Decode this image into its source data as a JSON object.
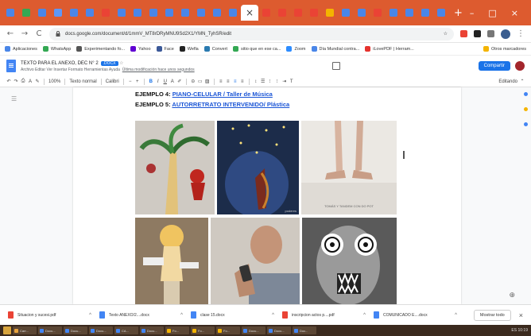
{
  "browser": {
    "tabs": [
      {
        "color": "#4a86e8"
      },
      {
        "color": "#34a853"
      },
      {
        "color": "#4a86e8"
      },
      {
        "color": "#5e97f6"
      },
      {
        "color": "#4a86e8"
      },
      {
        "color": "#4a86e8"
      },
      {
        "color": "#ea4335"
      },
      {
        "color": "#4a86e8"
      },
      {
        "color": "#4a86e8"
      },
      {
        "color": "#4a86e8"
      },
      {
        "color": "#4a86e8"
      },
      {
        "color": "#4a86e8"
      },
      {
        "color": "#4a86e8"
      },
      {
        "color": "#4a86e8"
      },
      {
        "color": "#4a86e8"
      }
    ],
    "active_tab_close": "×",
    "tabs_right": [
      {
        "color": "#ea4335"
      },
      {
        "color": "#ea4335"
      },
      {
        "color": "#ea4335"
      },
      {
        "color": "#ea4335"
      },
      {
        "color": "#f4b400"
      },
      {
        "color": "#4a86e8"
      },
      {
        "color": "#4a86e8"
      },
      {
        "color": "#ea4335"
      },
      {
        "color": "#4a86e8"
      },
      {
        "color": "#4a86e8"
      },
      {
        "color": "#4a86e8"
      },
      {
        "color": "#4a86e8"
      }
    ],
    "new_tab": "+",
    "window_controls": [
      "–",
      "□",
      "×"
    ],
    "url": "docs.google.com/document/d/1mmV_MT8rDRyMNU9Sd2X1/YMN_TyhSR/edit",
    "nav": {
      "back": "←",
      "forward": "→",
      "reload": "C"
    }
  },
  "bookmarks": [
    {
      "label": "Aplicaciones",
      "color": "#4a86e8"
    },
    {
      "label": "WhatsApp",
      "color": "#34a853"
    },
    {
      "label": "Experimentando fo...",
      "color": "#555555"
    },
    {
      "label": "Yahoo",
      "color": "#6001d2"
    },
    {
      "label": "Face",
      "color": "#3b5998"
    },
    {
      "label": "Wefla",
      "color": "#222222"
    },
    {
      "label": "Convert",
      "color": "#2a7ab0"
    },
    {
      "label": "sitio que en ese ca...",
      "color": "#34a853"
    },
    {
      "label": "Zoom",
      "color": "#2d8cff"
    },
    {
      "label": "Día Mundial contra...",
      "color": "#4a86e8"
    },
    {
      "label": "iLovePDF | Herram...",
      "color": "#e5322d"
    }
  ],
  "bookmarks_right": "Otros marcadores",
  "doc": {
    "title": "TEXTO PARA EL ANEXO, DEC N° 2",
    "title_badge": ".DOCX",
    "menu": "Archivo  Editar  Ver  Insertar  Formato  Herramientas  Ayuda",
    "edit_status": "Última modificación hace unos segundos",
    "share": "Compartir"
  },
  "toolbar": {
    "zoom": "100%",
    "style": "Texto normal",
    "font": "Calibri",
    "mode": "Editando"
  },
  "content": {
    "ex4_label": "EJEMPLO 4: ",
    "ex4_link": "PIANO-CELULAR / Taller de Música",
    "ex5_label": "EJEMPLO 5: ",
    "ex5_link": "AUTORRETRATO INTERVENIDO/ Plástica",
    "img3_caption": "TOMÁS Y TANDEM CON DO POT",
    "img2_caption": "poderes"
  },
  "downloads": [
    {
      "label": "Situacion y sucesi.pdf",
      "color": "#ea4335"
    },
    {
      "label": "Texto ANEXO/2....docx",
      "color": "#4285f4"
    },
    {
      "label": "clase 15.docx",
      "color": "#4285f4"
    },
    {
      "label": "inscripcion actos p....pdf",
      "color": "#ea4335"
    },
    {
      "label": "COMUNICADO E....docx",
      "color": "#4285f4"
    }
  ],
  "show_all": "Mostrar todo",
  "close_downloads": "×",
  "taskbar": [
    {
      "label": "Carr...",
      "color": "#e8a33d"
    },
    {
      "label": "Docu...",
      "color": "#4285f4"
    },
    {
      "label": "Docu...",
      "color": "#4285f4"
    },
    {
      "label": "Docu...",
      "color": "#4285f4"
    },
    {
      "label": "CA...",
      "color": "#4285f4"
    },
    {
      "label": "Docu...",
      "color": "#4285f4"
    },
    {
      "label": "Fo...",
      "color": "#f4b400"
    },
    {
      "label": "Fo...",
      "color": "#f4b400"
    },
    {
      "label": "Fo...",
      "color": "#f4b400"
    },
    {
      "label": "Docu...",
      "color": "#4285f4"
    },
    {
      "label": "Docu...",
      "color": "#4285f4"
    },
    {
      "label": "Doc...",
      "color": "#4285f4"
    }
  ],
  "tray": "ES  10:19"
}
